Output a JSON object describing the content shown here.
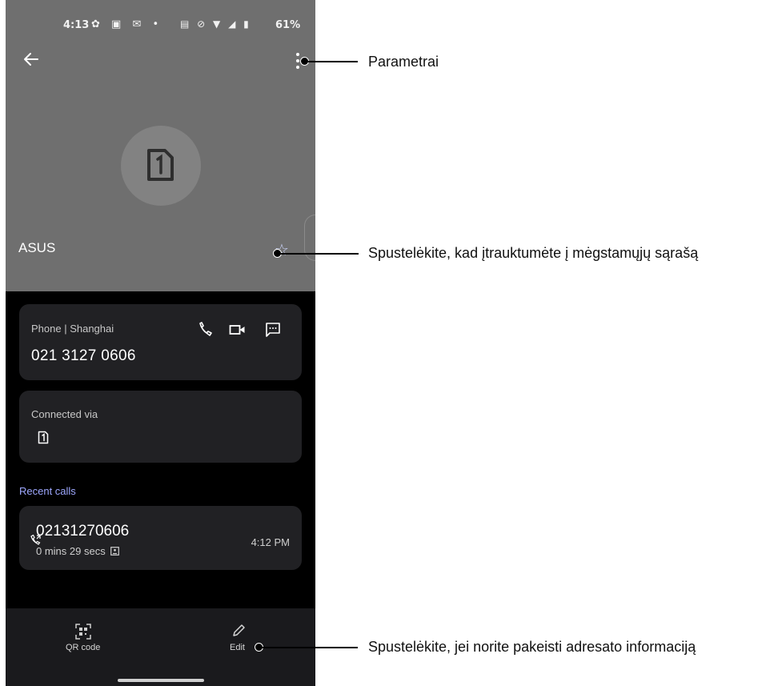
{
  "status_bar": {
    "time": "4:13",
    "battery": "61%"
  },
  "contact": {
    "name": "ASUS"
  },
  "phone_card": {
    "label": "Phone | Shanghai",
    "number": "021 3127 0606"
  },
  "connected_card": {
    "label": "Connected via"
  },
  "recent_calls": {
    "heading": "Recent calls",
    "items": [
      {
        "number": "02131270606",
        "duration": "0 mins 29 secs",
        "time": "4:12 PM"
      }
    ]
  },
  "bottom_bar": {
    "qr_label": "QR code",
    "edit_label": "Edit"
  },
  "callouts": {
    "menu": "Parametrai",
    "favorite": "Spustelėkite, kad įtrauktumėte į mėgstamųjų sąrašą",
    "edit": "Spustelėkite, jei norite pakeisti adresato informaciją"
  },
  "colors": {
    "header": "#6f6f6f",
    "card": "#212124",
    "accent": "#9ea8ff",
    "background": "#000000"
  },
  "icons": [
    "back-arrow-icon",
    "more-vert-icon",
    "sim-card-icon",
    "star-outline-icon",
    "phone-icon",
    "video-call-icon",
    "message-icon",
    "sim-card-small-icon",
    "outgoing-call-icon",
    "contact-card-icon",
    "qr-code-icon",
    "pencil-icon"
  ]
}
